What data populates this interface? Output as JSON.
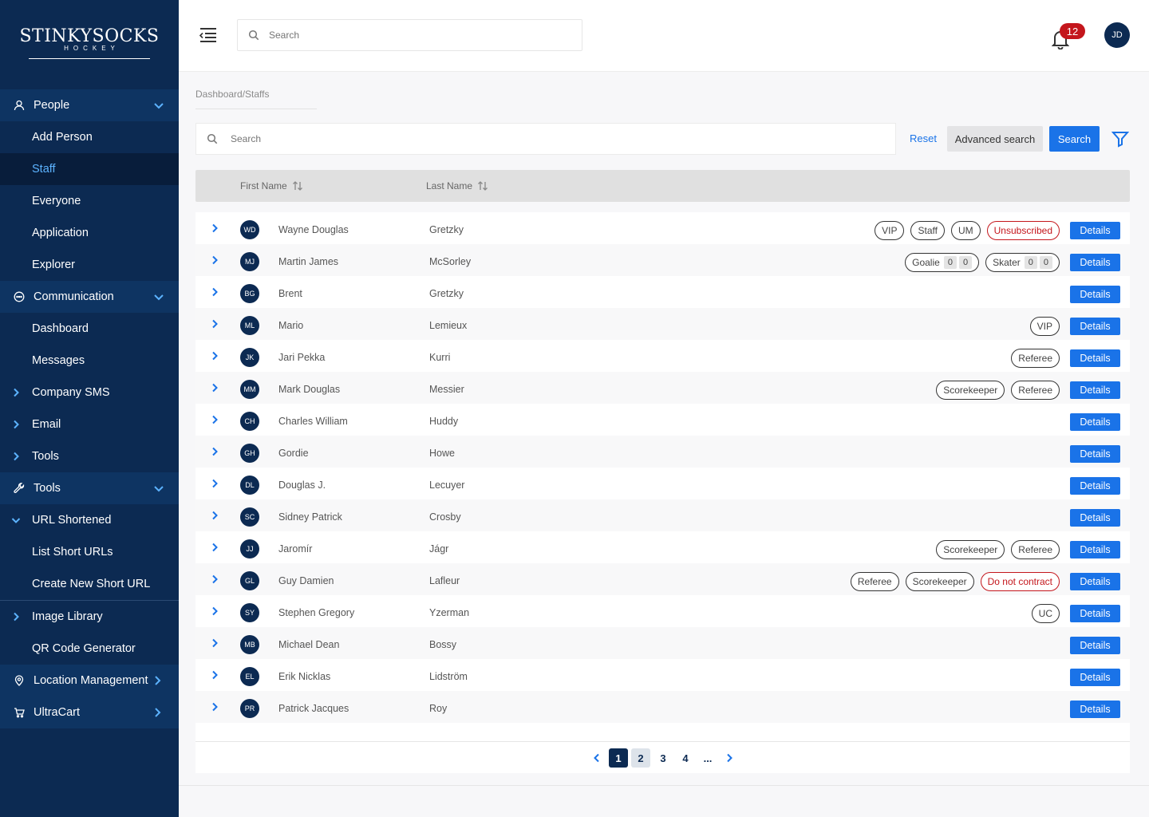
{
  "brand": {
    "name": "STINKYSOCKS",
    "sub": "HOCKEY"
  },
  "sidebar": {
    "people": {
      "label": "People",
      "items": [
        {
          "label": "Add Person"
        },
        {
          "label": "Staff"
        },
        {
          "label": "Everyone"
        },
        {
          "label": "Application"
        },
        {
          "label": "Explorer"
        }
      ]
    },
    "communication": {
      "label": "Communication",
      "items": [
        {
          "label": "Dashboard"
        },
        {
          "label": "Messages"
        },
        {
          "label": "Company SMS"
        },
        {
          "label": "Email"
        },
        {
          "label": "Tools"
        }
      ]
    },
    "tools": {
      "label": "Tools",
      "items": [
        {
          "label": "URL Shortened"
        },
        {
          "label": "List Short URLs"
        },
        {
          "label": "Create New Short URL"
        },
        {
          "label": "Image Library"
        },
        {
          "label": "QR Code Generator"
        }
      ]
    },
    "location": {
      "label": "Location Management"
    },
    "ultracart": {
      "label": "UltraCart"
    }
  },
  "topbar": {
    "search_placeholder": "Search",
    "notification_count": "12",
    "user_initials": "JD"
  },
  "breadcrumb": "Dashboard/Staffs",
  "filters": {
    "search_placeholder": "Search",
    "reset_label": "Reset",
    "advanced_label": "Advanced search",
    "search_label": "Search"
  },
  "table": {
    "columns": [
      "First Name",
      "Last Name"
    ],
    "details_label": "Details",
    "rows": [
      {
        "initials": "WD",
        "first": "Wayne Douglas",
        "last": "Gretzky",
        "tags": [
          {
            "text": "VIP"
          },
          {
            "text": "Staff"
          },
          {
            "text": "UM"
          },
          {
            "text": "Unsubscribed",
            "red": true
          }
        ]
      },
      {
        "initials": "MJ",
        "first": "Martin James",
        "last": "McSorley",
        "tags": [
          {
            "text": "Goalie",
            "counts": [
              "0",
              "0"
            ]
          },
          {
            "text": "Skater",
            "counts": [
              "0",
              "0"
            ]
          }
        ]
      },
      {
        "initials": "BG",
        "first": "Brent",
        "last": "Gretzky",
        "tags": []
      },
      {
        "initials": "ML",
        "first": "Mario",
        "last": "Lemieux",
        "tags": [
          {
            "text": "VIP"
          }
        ]
      },
      {
        "initials": "JK",
        "first": "Jari Pekka",
        "last": "Kurri",
        "tags": [
          {
            "text": "Referee"
          }
        ]
      },
      {
        "initials": "MM",
        "first": "Mark Douglas",
        "last": "Messier",
        "tags": [
          {
            "text": "Scorekeeper"
          },
          {
            "text": "Referee"
          }
        ]
      },
      {
        "initials": "CH",
        "first": "Charles William",
        "last": "Huddy",
        "tags": []
      },
      {
        "initials": "GH",
        "first": "Gordie",
        "last": "Howe",
        "tags": []
      },
      {
        "initials": "DL",
        "first": "Douglas J.",
        "last": "Lecuyer",
        "tags": []
      },
      {
        "initials": "SC",
        "first": "Sidney Patrick",
        "last": "Crosby",
        "tags": []
      },
      {
        "initials": "JJ",
        "first": "Jaromír",
        "last": "Jágr",
        "tags": [
          {
            "text": "Scorekeeper"
          },
          {
            "text": "Referee"
          }
        ]
      },
      {
        "initials": "GL",
        "first": "Guy Damien",
        "last": "Lafleur",
        "tags": [
          {
            "text": "Referee"
          },
          {
            "text": "Scorekeeper"
          },
          {
            "text": "Do not contract",
            "red": true
          }
        ]
      },
      {
        "initials": "SY",
        "first": "Stephen Gregory",
        "last": "Yzerman",
        "tags": [
          {
            "text": "UC"
          }
        ]
      },
      {
        "initials": "MB",
        "first": "Michael Dean",
        "last": "Bossy",
        "tags": []
      },
      {
        "initials": "EL",
        "first": "Erik Nicklas",
        "last": "Lidström",
        "tags": []
      },
      {
        "initials": "PR",
        "first": "Patrick Jacques",
        "last": "Roy",
        "tags": []
      }
    ]
  },
  "pagination": {
    "pages": [
      "1",
      "2",
      "3",
      "4"
    ],
    "ellipsis": "...",
    "current": "1"
  },
  "colors": {
    "sidebar": "#0c2a52",
    "accent": "#1a73e8",
    "danger": "#c4161c"
  }
}
